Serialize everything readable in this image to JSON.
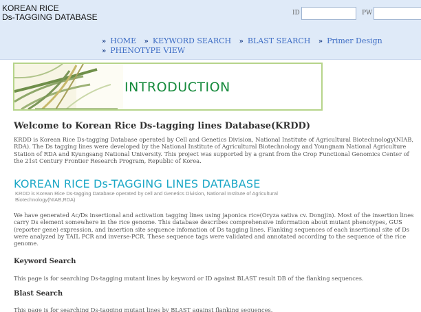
{
  "header": {
    "site_title": "KOREAN RICE\nDs-TAGGING DATABASE",
    "id_label": "ID",
    "pw_label": "PW",
    "id_value": "",
    "pw_value": ""
  },
  "nav": {
    "separator": "»",
    "items": [
      {
        "label": "HOME"
      },
      {
        "label": "KEYWORD SEARCH"
      },
      {
        "label": "BLAST SEARCH"
      },
      {
        "label": "Primer Design"
      },
      {
        "label": "PHENOTYPE VIEW"
      }
    ]
  },
  "banner": {
    "title": "INTRODUCTION"
  },
  "content": {
    "welcome_title": "Welcome to Korean Rice Ds-tagging lines Database(KRDD)",
    "intro_paragraph": "KRDD is Korean Rice Ds-tagging Database operated by Cell and Genetics Division, National Institute of Agricultural Biotechnology(NIAB, RDA). The Ds tagging lines were developed by the National Institute of Agricultural Biotechnology and Youngnam National Agriculture Station of RDA and Kyungsang National University. This project was supported by a grant from the Crop Functional Genomics Center of the 21st Century Frontier Research Program, Republic of Korea.",
    "logo_title": "KOREAN RICE Ds-TAGGING LINES DATABASE",
    "logo_subtitle": "KRDD is Korean Rice Ds-tagging Database operated by cell and Genetics Division, National Institute of Agricultural Biotechnology(NIAB,RDA)",
    "generation_paragraph": "We have generated Ac/Ds insertional and activation tagging lines using japonica rice(Oryza sativa cv. Dongjin). Most of the insertion lines carry Ds element somewhere in the rice genome. This database describes comprehensive information about mutant phenotypes, GUS (reporter gene) expression, and insertion site sequence infomation of Ds tagging lines. Flanking sequences of each insertional site of Ds were analyzed by TAIL PCR and inverse-PCR. These sequence tags were validated and annotated according to the sequence of the rice genome.",
    "keyword_heading": "Keyword Search",
    "keyword_text": "This page is for searching Ds-tagging mutant lines by keyword or ID against BLAST result DB of the flanking sequences.",
    "blast_heading": "Blast Search",
    "blast_text": "This page is for searching Ds-tagging mutant lines by BLAST against flanking sequences."
  },
  "colors": {
    "header_bg": "#dfeaf8",
    "nav_link": "#3d6cc4",
    "banner_border": "#b6d48a",
    "banner_title": "#168a3c",
    "logo_title": "#1ba7c6"
  }
}
